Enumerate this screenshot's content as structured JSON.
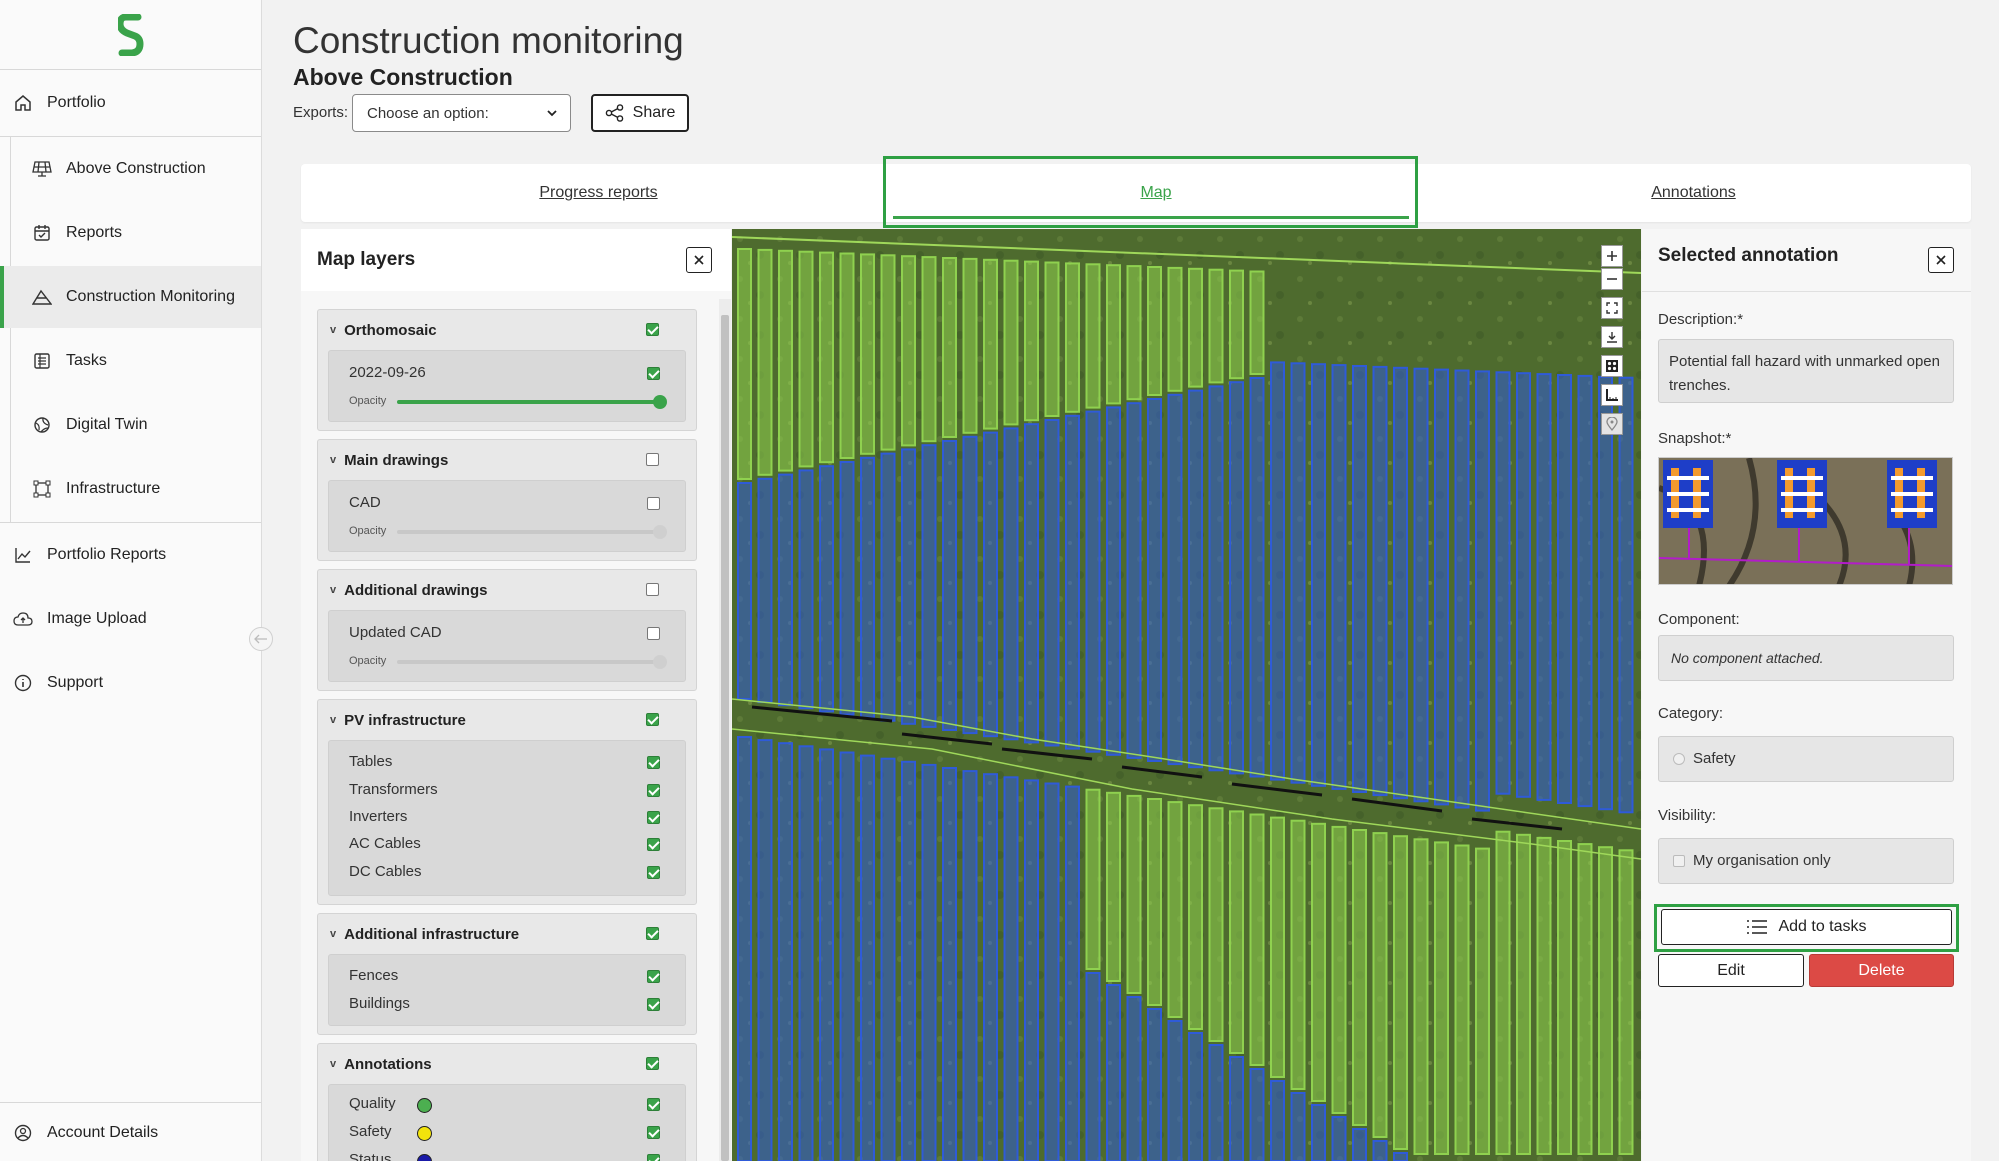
{
  "sidebar": {
    "items": [
      {
        "label": "Portfolio",
        "icon": "home-icon"
      },
      {
        "label": "Above Construction",
        "icon": "solar-panel-icon"
      },
      {
        "label": "Reports",
        "icon": "calendar-check-icon"
      },
      {
        "label": "Construction Monitoring",
        "icon": "terrain-icon"
      },
      {
        "label": "Tasks",
        "icon": "task-list-icon"
      },
      {
        "label": "Digital Twin",
        "icon": "globe-icon"
      },
      {
        "label": "Infrastructure",
        "icon": "vector-square-icon"
      },
      {
        "label": "Portfolio Reports",
        "icon": "line-chart-icon"
      },
      {
        "label": "Image Upload",
        "icon": "cloud-upload-icon"
      },
      {
        "label": "Support",
        "icon": "info-circle-icon"
      },
      {
        "label": "Account Details",
        "icon": "user-circle-icon"
      }
    ],
    "accent_color": "#3aa34a"
  },
  "header": {
    "title": "Construction monitoring",
    "subtitle": "Above Construction",
    "exports_label": "Exports:",
    "exports_value": "Choose an option:",
    "share_label": "Share"
  },
  "tabs": [
    {
      "label": "Progress reports"
    },
    {
      "label": "Map"
    },
    {
      "label": "Annotations"
    }
  ],
  "layers": {
    "title": "Map layers",
    "groups": [
      {
        "name": "Orthomosaic",
        "checked": true,
        "items": [
          {
            "label": "2022-09-26",
            "checked": true
          }
        ],
        "opacity_label": "Opacity",
        "opacity": 1.0
      },
      {
        "name": "Main drawings",
        "checked": false,
        "items": [
          {
            "label": "CAD",
            "checked": false
          }
        ],
        "opacity_label": "Opacity",
        "opacity": 0.0
      },
      {
        "name": "Additional drawings",
        "checked": false,
        "items": [
          {
            "label": "Updated CAD",
            "checked": false
          }
        ],
        "opacity_label": "Opacity",
        "opacity": 0.0
      },
      {
        "name": "PV infrastructure",
        "checked": true,
        "items": [
          {
            "label": "Tables",
            "checked": true
          },
          {
            "label": "Transformers",
            "checked": true
          },
          {
            "label": "Inverters",
            "checked": true
          },
          {
            "label": "AC Cables",
            "checked": true
          },
          {
            "label": "DC Cables",
            "checked": true
          }
        ]
      },
      {
        "name": "Additional infrastructure",
        "checked": true,
        "items": [
          {
            "label": "Fences",
            "checked": true
          },
          {
            "label": "Buildings",
            "checked": true
          }
        ]
      },
      {
        "name": "Annotations",
        "checked": true,
        "items": [
          {
            "label": "Quality",
            "checked": true,
            "color": "#4caf50"
          },
          {
            "label": "Safety",
            "checked": true,
            "color": "#f2e30c"
          },
          {
            "label": "Status",
            "checked": true,
            "color": "#1a1aa8"
          }
        ]
      }
    ]
  },
  "map": {
    "tools": [
      "zoom-in-icon",
      "zoom-out-icon",
      "fullscreen-icon",
      "download-icon",
      "layers-grid-icon",
      "measure-icon",
      "location-pin-icon"
    ],
    "colors": {
      "green_rows": "#8fd14f",
      "blue_rows": "#2f5bd8",
      "ground": "#4d6a2c"
    }
  },
  "annotation": {
    "title": "Selected annotation",
    "description_label": "Description:*",
    "description": "Potential fall hazard with unmarked open trenches.",
    "snapshot_label": "Snapshot:*",
    "component_label": "Component:",
    "component_value": "No component attached.",
    "category_label": "Category:",
    "category_value": "Safety",
    "visibility_label": "Visibility:",
    "visibility_value": "My organisation only",
    "add_tasks_label": "Add to tasks",
    "edit_label": "Edit",
    "delete_label": "Delete",
    "delete_color": "#dc4a45"
  }
}
